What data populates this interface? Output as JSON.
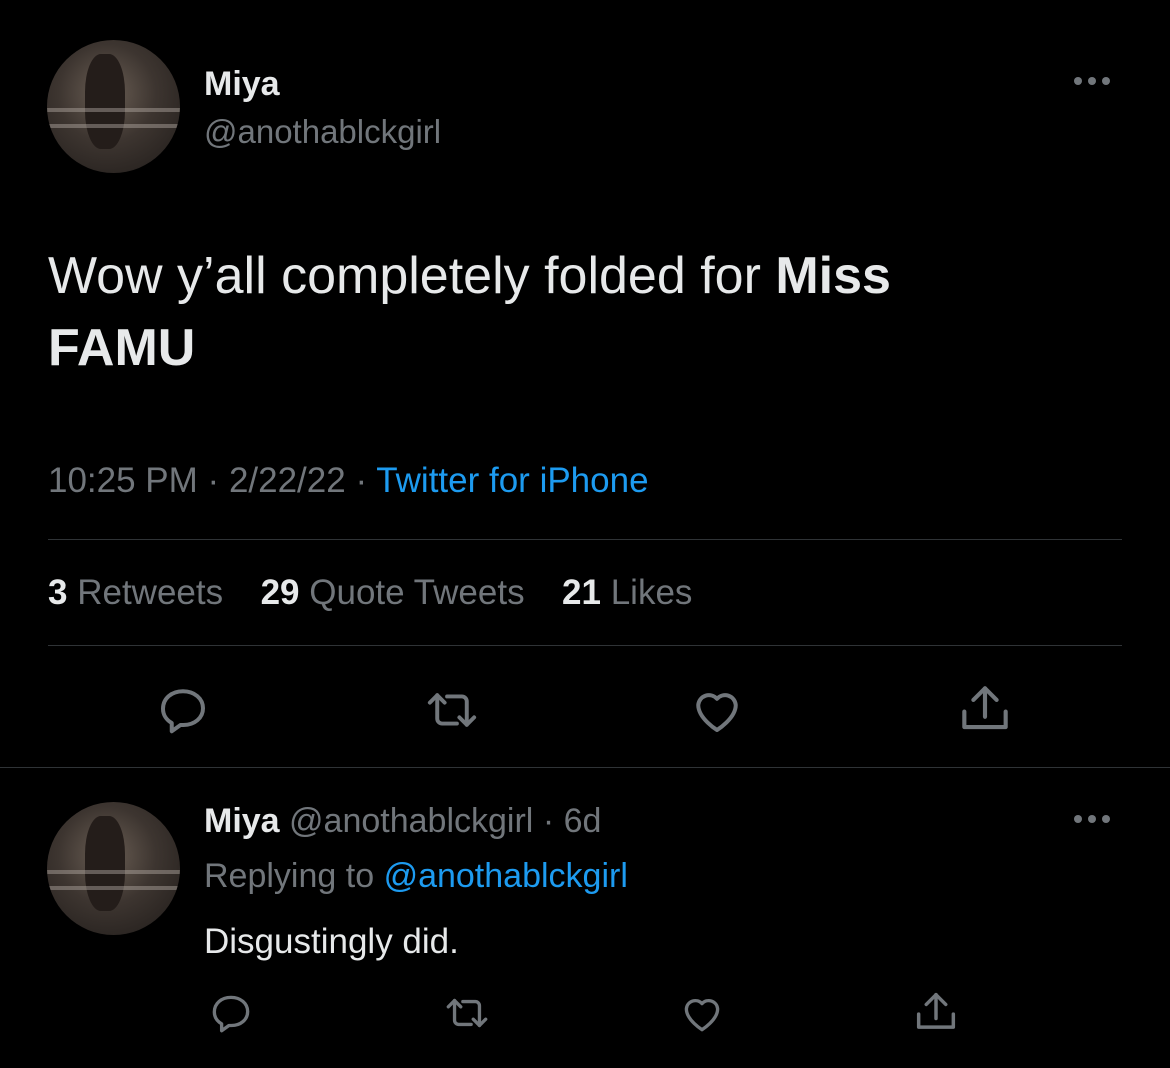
{
  "main_tweet": {
    "author_name": "Miya",
    "author_handle": "@anothablckgirl",
    "text_part1": "Wow y’all completely folded for ",
    "text_bold": "Miss FAMU",
    "time": "10:25 PM",
    "sep1": "·",
    "date": "2/22/22",
    "sep2": "·",
    "source": "Twitter for iPhone",
    "stats": {
      "retweets_count": "3",
      "retweets_label": "Retweets",
      "quotes_count": "29",
      "quotes_label": "Quote Tweets",
      "likes_count": "21",
      "likes_label": "Likes"
    }
  },
  "reply_tweet": {
    "author_name": "Miya",
    "author_handle": "@anothablckgirl",
    "sep": "·",
    "age": "6d",
    "replying_prefix": "Replying to",
    "replying_handle": "@anothablckgirl",
    "text": "Disgustingly did."
  },
  "icons": [
    "reply-icon",
    "retweet-icon",
    "like-icon",
    "share-icon",
    "more-icon"
  ],
  "colors": {
    "background": "#000000",
    "text": "#e7e9ea",
    "muted": "#71767b",
    "link": "#1d9bf0",
    "divider": "#2f3336"
  }
}
